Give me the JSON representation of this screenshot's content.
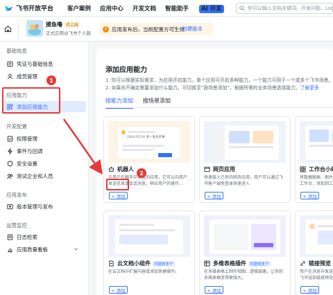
{
  "topbar": {
    "logo": "飞书开放平台",
    "nav": [
      "客户案例",
      "应用中心",
      "开发文档",
      "智能助手"
    ],
    "ai_badge": "AI 开发",
    "search_placeholder": "你可以输入文档关键词、开发问题、Log ID"
  },
  "app": {
    "name": "摸鱼噜",
    "status": "待上线",
    "subtitle": "正式应用@飞书个人版"
  },
  "notice": {
    "text": "应用发布后，当前配置方可生效",
    "action": "创建版本"
  },
  "sidebar": {
    "sections": [
      {
        "title": "基础信息",
        "items": [
          "凭证与基础信息",
          "成员管理"
        ]
      },
      {
        "title": "应用能力",
        "items": [
          "添加应用能力"
        ]
      },
      {
        "title": "开发配置",
        "items": [
          "权限管理",
          "事件与回调",
          "安全设置",
          "测试企业和人员"
        ]
      },
      {
        "title": "应用发布",
        "items": [
          "版本管理与发布"
        ]
      },
      {
        "title": "运营监控",
        "items": [
          "日志检索",
          "应用质量看板"
        ]
      }
    ],
    "active": "添加应用能力"
  },
  "main": {
    "title": "添加应用能力",
    "desc1": "1. 你可以根据实际需求，为应用开启能力。单个应用可开启多种能力，一个能力可用于一个或多个飞书场景。",
    "desc2_prefix": "2. 如果尚不确定需要添加什么能力，可切换至“按场景添加”，根据所需的业务场景选择能力。",
    "learn_more": "了解更多",
    "tabs": [
      "按能力添加",
      "按场景添加"
    ],
    "active_tab": "按能力添加",
    "add_label": "+ 添加",
    "cards": [
      {
        "title": "机器人",
        "badge": "",
        "desc": "与用户在聊天中交互的应用，它可以向用户发送信息或会话消息，响应用户的操作…",
        "thumb_date": "2024-05-20 周一发生的事"
      },
      {
        "title": "网页应用",
        "badge": "",
        "desc": "快速接入已有的网页应用，用户可以通过飞书客户端免登录快速进入",
        "thumb_date": ""
      },
      {
        "title": "工作台小组件",
        "badge": "",
        "desc": "将数据图表、图片或其他信息添加到用户的工作台，添加到工作台",
        "thumb_date": ""
      },
      {
        "title": "云文档小组件",
        "badge": "可提效多个",
        "desc": "在云文档中扩展内容或添加快捷操作。",
        "thumb_date": ""
      },
      {
        "title": "多维表格插件",
        "badge": "可提效多个",
        "desc": "在多维表格上制作视图、逻辑链路，让你的多维表格变得更强大。",
        "thumb_date": ""
      },
      {
        "title": "链接预览",
        "badge": "",
        "desc": "用户在消息中发送链接后，由应用处理产生飞书渲染链接预览",
        "thumb_date": ""
      }
    ]
  },
  "annotations": [
    "1",
    "2"
  ],
  "colors": {
    "accent": "#3370ff",
    "highlight": "#e43a3a",
    "notice_bg": "#fff5e6"
  }
}
